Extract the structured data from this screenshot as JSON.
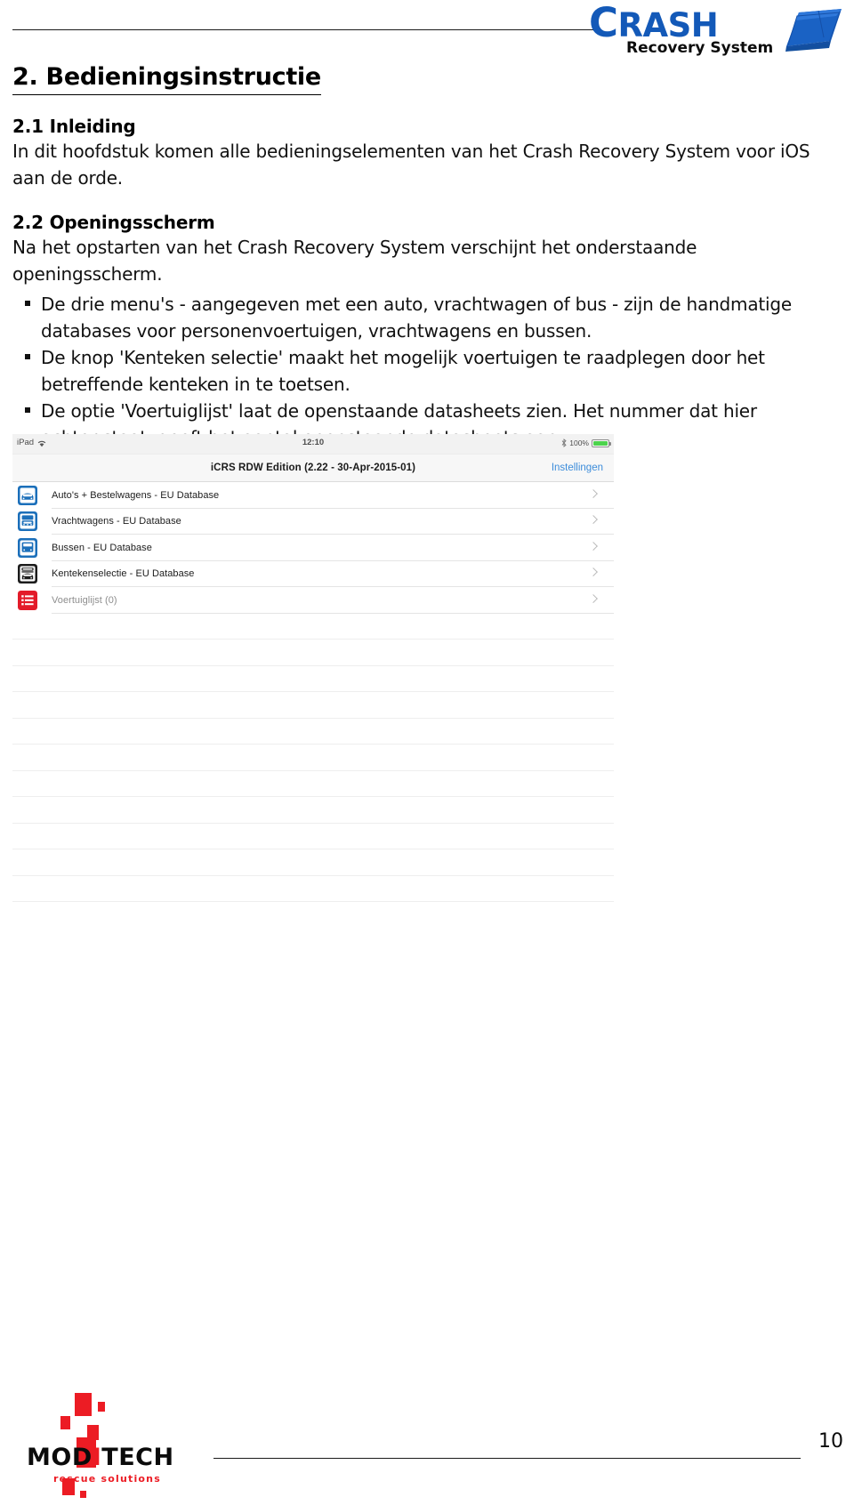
{
  "header": {
    "logo": {
      "wordmark_c": "C",
      "wordmark_rest": "RASH",
      "subtitle": "Recovery System",
      "brand_color": "#1359b8",
      "cube_icon": "blue-cube-icon"
    }
  },
  "document": {
    "chapter_title": "2. Bedieningsinstructie",
    "sections": [
      {
        "heading": "2.1 Inleiding",
        "paragraphs": [
          "In dit hoofdstuk komen alle bedieningselementen van het Crash Recovery System voor iOS aan de orde."
        ]
      },
      {
        "heading": "2.2 Openingsscherm",
        "paragraphs": [
          "Na het opstarten van het Crash Recovery System verschijnt het onderstaande openingsscherm."
        ]
      }
    ],
    "bullets": [
      "De drie menu's - aangegeven met een auto, vrachtwagen of bus - zijn de handmatige databases voor personenvoertuigen, vrachtwagens en bussen.",
      "De knop 'Kenteken selectie' maakt het mogelijk voertuigen te raadplegen door het betreffende kenteken in te toetsen.",
      "De optie 'Voertuiglijst' laat de openstaande datasheets zien. Het nummer dat hier achter staat, geeft het aantal openstaande datasheets aan."
    ]
  },
  "ipad_screenshot": {
    "status_bar": {
      "device_label": "iPad",
      "wifi_icon": "wifi-icon",
      "time": "12:10",
      "bluetooth_icon": "bluetooth-icon",
      "battery_percent": "100%",
      "battery_icon": "battery-full-icon"
    },
    "nav_bar": {
      "title": "iCRS RDW Edition (2.22 - 30-Apr-2015-01)",
      "right_action": "Instellingen",
      "action_color": "#3c8cda"
    },
    "menu_rows": [
      {
        "label": "Auto's + Bestelwagens - EU Database",
        "icon": "car-icon",
        "icon_color": "#1b6fba",
        "dim": false,
        "chevron": "chevron-right-icon"
      },
      {
        "label": "Vrachtwagens - EU Database",
        "icon": "truck-icon",
        "icon_color": "#1b6fba",
        "dim": false,
        "chevron": "chevron-right-icon"
      },
      {
        "label": "Bussen - EU Database",
        "icon": "bus-icon",
        "icon_color": "#1b6fba",
        "dim": false,
        "chevron": "chevron-right-icon"
      },
      {
        "label": "Kentekenselectie - EU Database",
        "icon": "licence-plate-icon",
        "icon_color": "#1c1c1c",
        "dim": false,
        "chevron": "chevron-right-icon"
      },
      {
        "label": "Voertuiglijst (0)",
        "icon": "list-icon",
        "icon_color": "#e31b29",
        "dim": true,
        "chevron": "chevron-right-icon"
      }
    ],
    "empty_row_count": 11
  },
  "footer": {
    "logo": {
      "word_mod": "MOD",
      "word_i": "I",
      "word_tech": "TECH",
      "tagline": "rescue solutions",
      "accent_color": "#ec1c24"
    },
    "page_number": "10"
  }
}
